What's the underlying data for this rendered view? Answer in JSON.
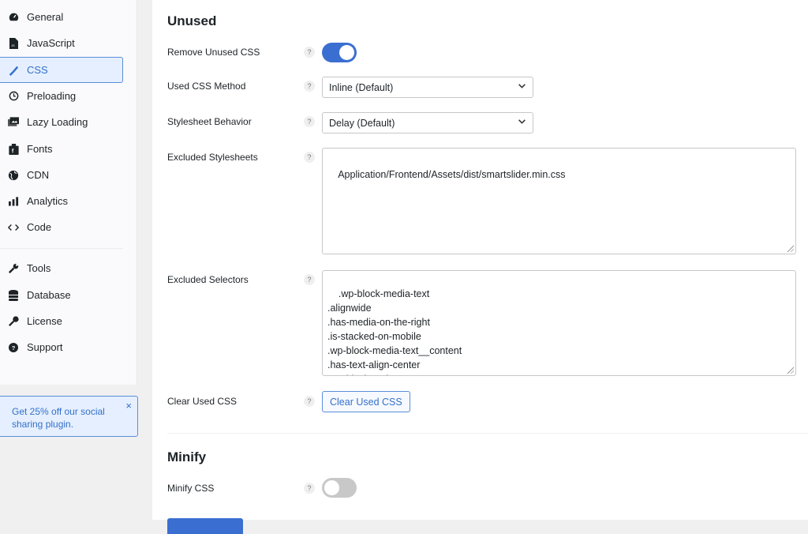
{
  "sidebar": {
    "items": [
      {
        "label": "General",
        "icon": "gauge-icon"
      },
      {
        "label": "JavaScript",
        "icon": "js-file-icon"
      },
      {
        "label": "CSS",
        "icon": "paintbrush-icon",
        "active": true
      },
      {
        "label": "Preloading",
        "icon": "clock-icon"
      },
      {
        "label": "Lazy Loading",
        "icon": "images-icon"
      },
      {
        "label": "Fonts",
        "icon": "font-box-icon"
      },
      {
        "label": "CDN",
        "icon": "globe-icon"
      },
      {
        "label": "Analytics",
        "icon": "bar-chart-icon"
      },
      {
        "label": "Code",
        "icon": "code-icon"
      }
    ],
    "tools": [
      {
        "label": "Tools",
        "icon": "wrench-icon"
      },
      {
        "label": "Database",
        "icon": "database-icon"
      },
      {
        "label": "License",
        "icon": "key-icon"
      },
      {
        "label": "Support",
        "icon": "question-circle-icon"
      }
    ],
    "promo": {
      "text": "Get 25% off our social sharing plugin.",
      "close": "×"
    }
  },
  "main": {
    "unused": {
      "title": "Unused",
      "remove_unused_css": {
        "label": "Remove Unused CSS",
        "enabled": true
      },
      "used_css_method": {
        "label": "Used CSS Method",
        "value": "Inline (Default)"
      },
      "stylesheet_behavior": {
        "label": "Stylesheet Behavior",
        "value": "Delay (Default)"
      },
      "excluded_stylesheets": {
        "label": "Excluded Stylesheets",
        "value": "Application/Frontend/Assets/dist/smartslider.min.css"
      },
      "excluded_selectors": {
        "label": "Excluded Selectors",
        "value": ".wp-block-media-text\n.alignwide\n.has-media-on-the-right\n.is-stacked-on-mobile\n.wp-block-media-text__content\n.has-text-align-center\n.wp-block-code\n.code"
      },
      "clear_used_css": {
        "label": "Clear Used CSS",
        "button": "Clear Used CSS"
      }
    },
    "minify": {
      "title": "Minify",
      "minify_css": {
        "label": "Minify CSS",
        "enabled": false
      }
    },
    "help_glyph": "?",
    "chevron": "⌄"
  }
}
